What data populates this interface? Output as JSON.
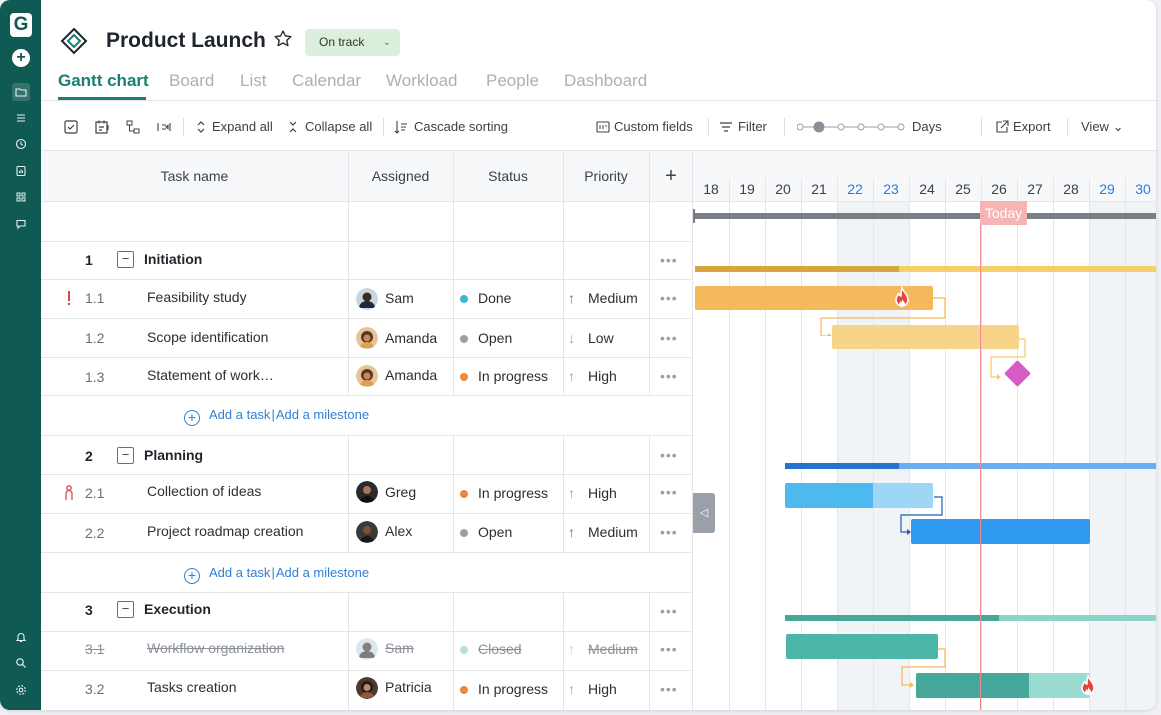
{
  "project": {
    "title": "Product Launch",
    "status": "On track",
    "logo_icon": "diamond-logo-icon"
  },
  "rail": {
    "logo": "G"
  },
  "tabs": [
    {
      "label": "Gantt chart"
    },
    {
      "label": "Board"
    },
    {
      "label": "List"
    },
    {
      "label": "Calendar"
    },
    {
      "label": "Workload"
    },
    {
      "label": "People"
    },
    {
      "label": "Dashboard"
    }
  ],
  "toolbar": {
    "expand_all": "Expand all",
    "collapse_all": "Collapse all",
    "cascade_sorting": "Cascade sorting",
    "custom_fields": "Custom fields",
    "filter": "Filter",
    "zoom_unit": "Days",
    "export": "Export",
    "view": "View"
  },
  "columns": {
    "task": "Task name",
    "assigned": "Assigned",
    "status": "Status",
    "priority": "Priority",
    "add": "+"
  },
  "groups": [
    {
      "num": "1",
      "name": "Initiation"
    },
    {
      "num": "2",
      "name": "Planning"
    },
    {
      "num": "3",
      "name": "Execution"
    }
  ],
  "tasks": [
    {
      "num": "1.1",
      "name": "Feasibility study",
      "assignee": "Sam",
      "status": "Done",
      "priority": "Medium",
      "priority_arrow": "↑"
    },
    {
      "num": "1.2",
      "name": "Scope identification",
      "assignee": "Amanda",
      "status": "Open",
      "priority": "Low",
      "priority_arrow": "↓"
    },
    {
      "num": "1.3",
      "name": "Statement of work…",
      "assignee": "Amanda",
      "status": "In progress",
      "priority": "High",
      "priority_arrow": "↑"
    },
    {
      "num": "2.1",
      "name": "Collection of ideas",
      "assignee": "Greg",
      "status": "In progress",
      "priority": "High",
      "priority_arrow": "↑"
    },
    {
      "num": "2.2",
      "name": "Project roadmap creation",
      "assignee": "Alex",
      "status": "Open",
      "priority": "Medium",
      "priority_arrow": "↑"
    },
    {
      "num": "3.1",
      "name": "Workflow organization",
      "assignee": "Sam",
      "status": "Closed",
      "priority": "Medium",
      "priority_arrow": "↑"
    },
    {
      "num": "3.2",
      "name": "Tasks creation",
      "assignee": "Patricia",
      "status": "In progress",
      "priority": "High",
      "priority_arrow": "↑"
    }
  ],
  "add_row": {
    "add_task": "Add a task",
    "separator": "|",
    "add_milestone": "Add a milestone"
  },
  "more_label": "•••",
  "timeline": {
    "days": [
      "18",
      "19",
      "20",
      "21",
      "22",
      "23",
      "24",
      "25",
      "26",
      "27",
      "28",
      "29",
      "30"
    ],
    "today_label": "Today"
  },
  "colors": {
    "brand": "#0f5a52",
    "accent": "#1a7f71",
    "done": "#3db5d6",
    "open": "#9aa0a8",
    "in_progress": "#f0883a",
    "closed": "#b8e2c8",
    "priority_up": "#2e9b4a",
    "priority_high": "#f0883a",
    "priority_low": "#a0a6ae"
  }
}
